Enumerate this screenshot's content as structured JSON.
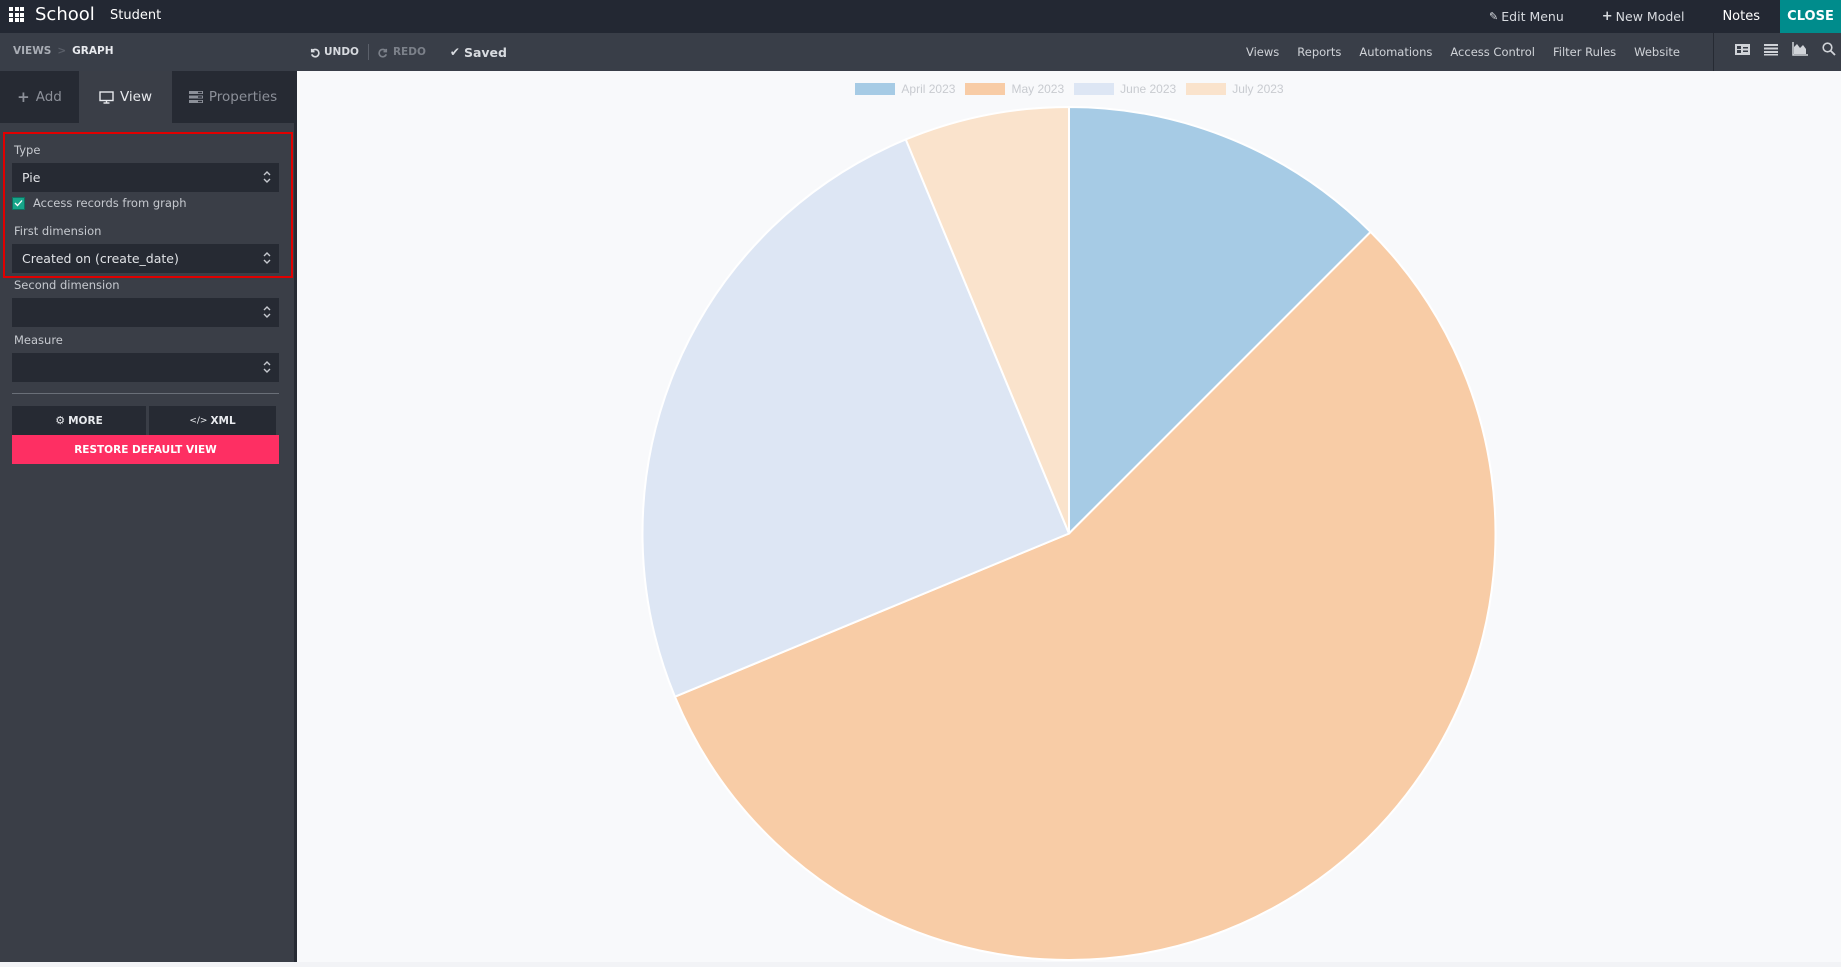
{
  "topbar": {
    "apps_icon": "grid-icon",
    "app_name": "School",
    "menu": "Student",
    "edit_menu": "Edit Menu",
    "edit_menu_icon": "pencil-icon",
    "new_model": "New Model",
    "new_model_icon": "plus-icon",
    "notes": "Notes",
    "close": "CLOSE",
    "close_color": "#008c8c"
  },
  "toolbar": {
    "breadcrumb": [
      "VIEWS",
      "GRAPH"
    ],
    "breadcrumb_sep": ">",
    "undo": "UNDO",
    "redo": "REDO",
    "saved": "Saved",
    "nav": [
      "Views",
      "Reports",
      "Automations",
      "Access Control",
      "Filter Rules",
      "Website"
    ],
    "view_icons": [
      "form-icon",
      "list-icon",
      "area-chart-icon",
      "search-icon"
    ]
  },
  "sidebar": {
    "tabs": [
      {
        "label": "Add",
        "icon": "plus-icon"
      },
      {
        "label": "View",
        "icon": "monitor-icon",
        "active": true
      },
      {
        "label": "Properties",
        "icon": "properties-icon"
      }
    ],
    "type_label": "Type",
    "type_value": "Pie",
    "access_records_label": "Access records from graph",
    "access_records_checked": true,
    "first_dimension_label": "First dimension",
    "first_dimension_value": "Created on (create_date)",
    "second_dimension_label": "Second dimension",
    "second_dimension_value": "",
    "measure_label": "Measure",
    "measure_value": "",
    "more_label": "MORE",
    "xml_label": "XML",
    "restore_label": "RESTORE DEFAULT VIEW",
    "restore_color": "#fe2f63",
    "highlight_color": "#e00000"
  },
  "chart_data": {
    "type": "pie",
    "title": "",
    "categories": [
      "April 2023",
      "May 2023",
      "June 2023",
      "July 2023"
    ],
    "values": [
      2,
      9,
      4,
      1
    ],
    "percentages": [
      12.5,
      56.25,
      25,
      6.25
    ],
    "colors": [
      "#a6cbe5",
      "#f8cca6",
      "#dde6f4",
      "#fae3cc"
    ],
    "legend_position": "top-center",
    "start_angle": "12 o'clock, clockwise"
  }
}
